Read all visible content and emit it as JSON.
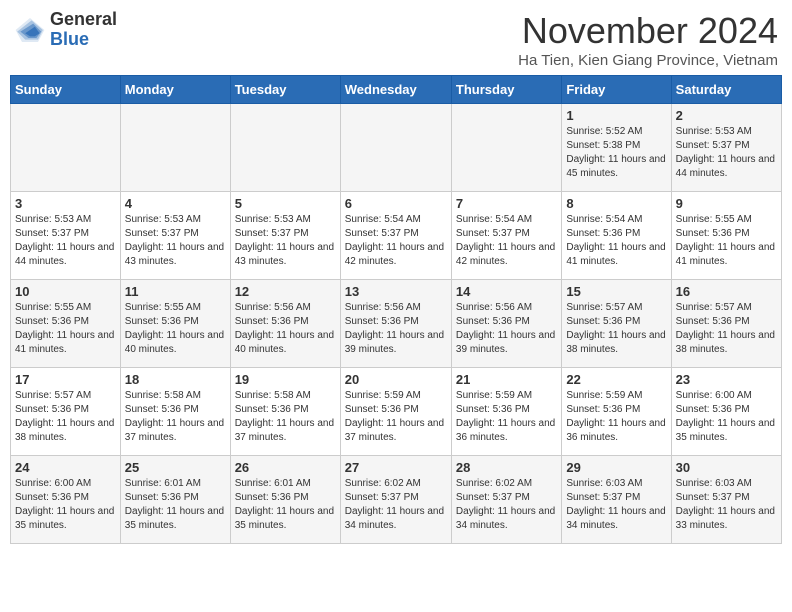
{
  "logo": {
    "general": "General",
    "blue": "Blue"
  },
  "title": "November 2024",
  "location": "Ha Tien, Kien Giang Province, Vietnam",
  "days_of_week": [
    "Sunday",
    "Monday",
    "Tuesday",
    "Wednesday",
    "Thursday",
    "Friday",
    "Saturday"
  ],
  "weeks": [
    [
      {
        "day": "",
        "info": ""
      },
      {
        "day": "",
        "info": ""
      },
      {
        "day": "",
        "info": ""
      },
      {
        "day": "",
        "info": ""
      },
      {
        "day": "",
        "info": ""
      },
      {
        "day": "1",
        "info": "Sunrise: 5:52 AM\nSunset: 5:38 PM\nDaylight: 11 hours and 45 minutes."
      },
      {
        "day": "2",
        "info": "Sunrise: 5:53 AM\nSunset: 5:37 PM\nDaylight: 11 hours and 44 minutes."
      }
    ],
    [
      {
        "day": "3",
        "info": "Sunrise: 5:53 AM\nSunset: 5:37 PM\nDaylight: 11 hours and 44 minutes."
      },
      {
        "day": "4",
        "info": "Sunrise: 5:53 AM\nSunset: 5:37 PM\nDaylight: 11 hours and 43 minutes."
      },
      {
        "day": "5",
        "info": "Sunrise: 5:53 AM\nSunset: 5:37 PM\nDaylight: 11 hours and 43 minutes."
      },
      {
        "day": "6",
        "info": "Sunrise: 5:54 AM\nSunset: 5:37 PM\nDaylight: 11 hours and 42 minutes."
      },
      {
        "day": "7",
        "info": "Sunrise: 5:54 AM\nSunset: 5:37 PM\nDaylight: 11 hours and 42 minutes."
      },
      {
        "day": "8",
        "info": "Sunrise: 5:54 AM\nSunset: 5:36 PM\nDaylight: 11 hours and 41 minutes."
      },
      {
        "day": "9",
        "info": "Sunrise: 5:55 AM\nSunset: 5:36 PM\nDaylight: 11 hours and 41 minutes."
      }
    ],
    [
      {
        "day": "10",
        "info": "Sunrise: 5:55 AM\nSunset: 5:36 PM\nDaylight: 11 hours and 41 minutes."
      },
      {
        "day": "11",
        "info": "Sunrise: 5:55 AM\nSunset: 5:36 PM\nDaylight: 11 hours and 40 minutes."
      },
      {
        "day": "12",
        "info": "Sunrise: 5:56 AM\nSunset: 5:36 PM\nDaylight: 11 hours and 40 minutes."
      },
      {
        "day": "13",
        "info": "Sunrise: 5:56 AM\nSunset: 5:36 PM\nDaylight: 11 hours and 39 minutes."
      },
      {
        "day": "14",
        "info": "Sunrise: 5:56 AM\nSunset: 5:36 PM\nDaylight: 11 hours and 39 minutes."
      },
      {
        "day": "15",
        "info": "Sunrise: 5:57 AM\nSunset: 5:36 PM\nDaylight: 11 hours and 38 minutes."
      },
      {
        "day": "16",
        "info": "Sunrise: 5:57 AM\nSunset: 5:36 PM\nDaylight: 11 hours and 38 minutes."
      }
    ],
    [
      {
        "day": "17",
        "info": "Sunrise: 5:57 AM\nSunset: 5:36 PM\nDaylight: 11 hours and 38 minutes."
      },
      {
        "day": "18",
        "info": "Sunrise: 5:58 AM\nSunset: 5:36 PM\nDaylight: 11 hours and 37 minutes."
      },
      {
        "day": "19",
        "info": "Sunrise: 5:58 AM\nSunset: 5:36 PM\nDaylight: 11 hours and 37 minutes."
      },
      {
        "day": "20",
        "info": "Sunrise: 5:59 AM\nSunset: 5:36 PM\nDaylight: 11 hours and 37 minutes."
      },
      {
        "day": "21",
        "info": "Sunrise: 5:59 AM\nSunset: 5:36 PM\nDaylight: 11 hours and 36 minutes."
      },
      {
        "day": "22",
        "info": "Sunrise: 5:59 AM\nSunset: 5:36 PM\nDaylight: 11 hours and 36 minutes."
      },
      {
        "day": "23",
        "info": "Sunrise: 6:00 AM\nSunset: 5:36 PM\nDaylight: 11 hours and 35 minutes."
      }
    ],
    [
      {
        "day": "24",
        "info": "Sunrise: 6:00 AM\nSunset: 5:36 PM\nDaylight: 11 hours and 35 minutes."
      },
      {
        "day": "25",
        "info": "Sunrise: 6:01 AM\nSunset: 5:36 PM\nDaylight: 11 hours and 35 minutes."
      },
      {
        "day": "26",
        "info": "Sunrise: 6:01 AM\nSunset: 5:36 PM\nDaylight: 11 hours and 35 minutes."
      },
      {
        "day": "27",
        "info": "Sunrise: 6:02 AM\nSunset: 5:37 PM\nDaylight: 11 hours and 34 minutes."
      },
      {
        "day": "28",
        "info": "Sunrise: 6:02 AM\nSunset: 5:37 PM\nDaylight: 11 hours and 34 minutes."
      },
      {
        "day": "29",
        "info": "Sunrise: 6:03 AM\nSunset: 5:37 PM\nDaylight: 11 hours and 34 minutes."
      },
      {
        "day": "30",
        "info": "Sunrise: 6:03 AM\nSunset: 5:37 PM\nDaylight: 11 hours and 33 minutes."
      }
    ]
  ]
}
